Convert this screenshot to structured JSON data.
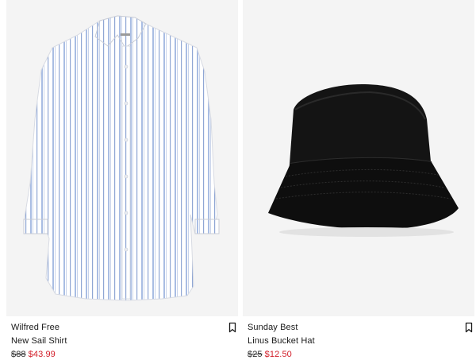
{
  "products": [
    {
      "brand": "Wilfred Free",
      "name": "New Sail Shirt",
      "original_price": "$88",
      "sale_price": "$43.99",
      "image_icon": "striped-shirt-image",
      "save_icon": "bookmark-icon"
    },
    {
      "brand": "Sunday Best",
      "name": "Linus Bucket Hat",
      "original_price": "$25",
      "sale_price": "$12.50",
      "image_icon": "black-bucket-hat-image",
      "save_icon": "bookmark-icon"
    }
  ],
  "colors": {
    "image_background": "#f4f4f4",
    "sale_price": "#d21f2a",
    "text": "#1a1a1a",
    "shirt_stripe": "#9fb3d9",
    "hat": "#111111"
  }
}
